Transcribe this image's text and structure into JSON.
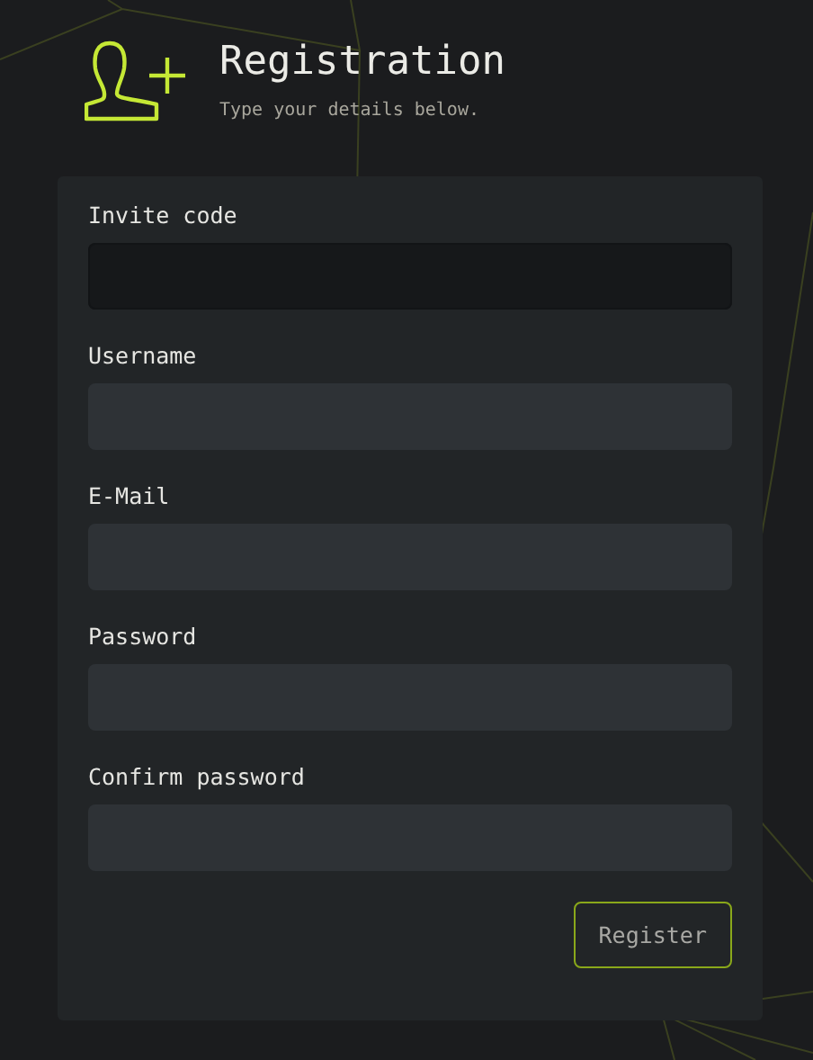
{
  "header": {
    "title": "Registration",
    "subtitle": "Type your details below."
  },
  "fields": [
    {
      "label": "Invite code",
      "focused": true
    },
    {
      "label": "Username",
      "focused": false
    },
    {
      "label": "E-Mail",
      "focused": false
    },
    {
      "label": "Password",
      "focused": false
    },
    {
      "label": "Confirm password",
      "focused": false
    }
  ],
  "submit": {
    "label": "Register"
  }
}
